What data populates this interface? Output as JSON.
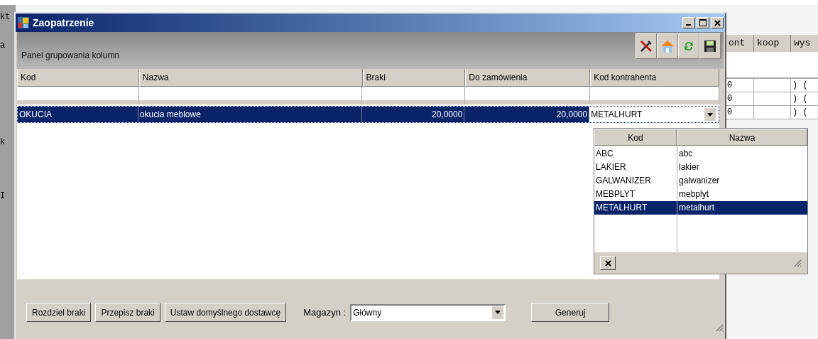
{
  "background_app": {
    "left_fragments": [
      "kt",
      "a",
      "k",
      "I"
    ],
    "columns": [
      "ont",
      "koop",
      "wys"
    ],
    "rows": [
      [
        "0",
        "",
        ") ("
      ],
      [
        "0",
        "",
        ") ("
      ],
      [
        "0",
        "",
        ") ("
      ]
    ]
  },
  "window": {
    "title": "Zaopatrzenie"
  },
  "group_panel": {
    "label": "Panel grupowania kolumn"
  },
  "toolbar": [
    {
      "kind": "tools"
    },
    {
      "kind": "home"
    },
    {
      "kind": "refresh"
    },
    {
      "kind": "save"
    }
  ],
  "grid": {
    "columns": [
      "Kod",
      "Nazwa",
      "Braki",
      "Do zamówienia",
      "Kod kontrahenta"
    ],
    "rows": [
      {
        "cells": [
          "OKUCIA",
          "okucia meblowe",
          "20,0000",
          "20,0000",
          "METALHURT"
        ],
        "selected": true
      }
    ]
  },
  "dropdown": {
    "columns": [
      "Kod",
      "Nazwa"
    ],
    "items": [
      {
        "kod": "ABC",
        "nazwa": "abc",
        "selected": false
      },
      {
        "kod": "LAKIER",
        "nazwa": "lakier",
        "selected": false
      },
      {
        "kod": "GALWANIZER",
        "nazwa": "galwanizer",
        "selected": false
      },
      {
        "kod": "MEBPLYT",
        "nazwa": "mebplyt",
        "selected": false
      },
      {
        "kod": "METALHURT",
        "nazwa": "metalhurt",
        "selected": true
      }
    ]
  },
  "buttons": [
    "Rozdziel braki",
    "Przepisz braki",
    "Ustaw domyślnego dostawcę"
  ],
  "magazyn": {
    "label": "Magazyn :",
    "value": "Główny"
  },
  "generate_button": "Generuj"
}
